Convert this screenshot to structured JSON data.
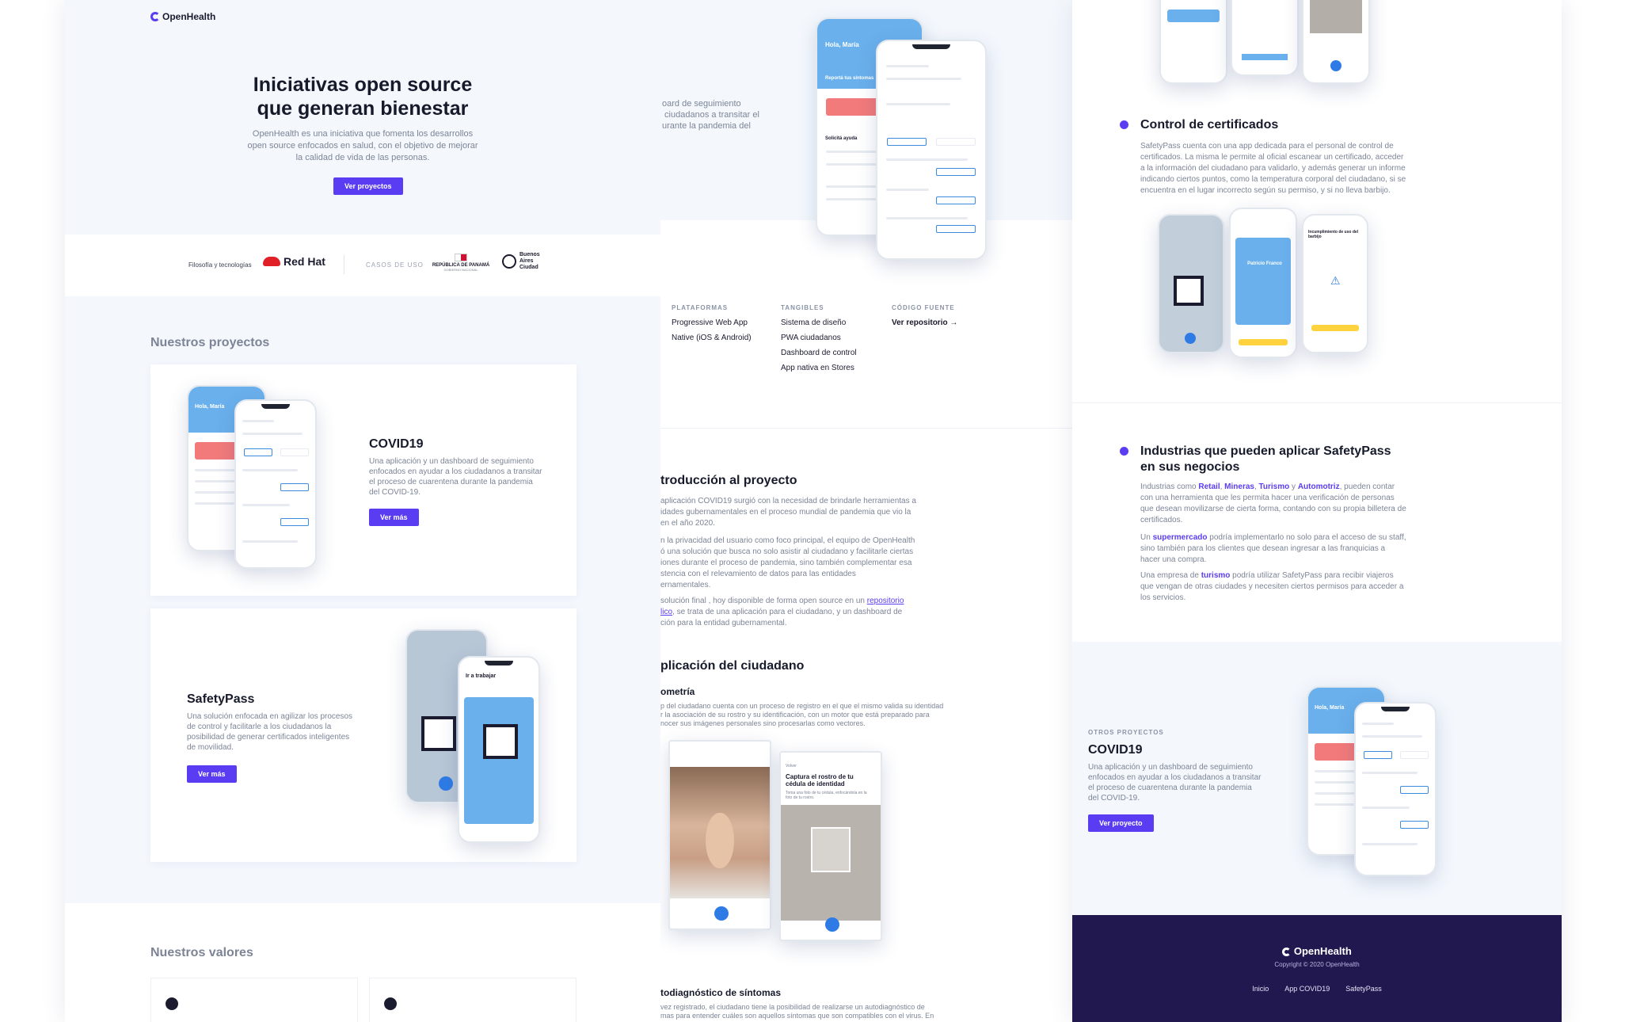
{
  "colors": {
    "accent": "#5a3df2",
    "footer_bg": "#21184f",
    "phone_blue": "#6ab0ec",
    "alert_red": "#f27a7a",
    "cta_yellow": "#ffd33d"
  },
  "brand": {
    "name": "OpenHealth"
  },
  "hero": {
    "title_line1": "Iniciativas open source",
    "title_line2": "que generan bienestar",
    "text": "OpenHealth es una iniciativa que fomenta los desarrollos open source enfocados en salud, con el objetivo de mejorar la calidad de vida de las personas.",
    "cta": "Ver proyectos"
  },
  "logos": {
    "filosofia": "Filosofía y tecnologías",
    "redhat": "Red Hat",
    "casos": "CASOS DE USO",
    "panama": "REPÚBLICA DE PANAMÁ",
    "panama_sub": "GOBIERNO NACIONAL",
    "ba_line1": "Buenos",
    "ba_line2": "Aires",
    "ba_line3": "Ciudad"
  },
  "projects": {
    "title": "Nuestros proyectos",
    "covid": {
      "title": "COVID19",
      "text": "Una aplicación y un dashboard de seguimiento enfocados en ayudar a los ciudadanos a transitar el proceso de cuarentena durante la pandemia del COVID-19.",
      "cta": "Ver más"
    },
    "safety": {
      "title": "SafetyPass",
      "text": "Una solución enfocada en agilizar los procesos de control y facilitarle a los ciudadanos la posibilidad de generar certificados inteligentes de movilidad.",
      "cta": "Ver más"
    }
  },
  "values": {
    "title": "Nuestros valores"
  },
  "detail": {
    "intro_cut": "oard de seguimiento\n ciudadanos a transitar el\nurante la pandemia del",
    "plataformas_head": "PLATAFORMAS",
    "plataformas": [
      "Progressive Web App",
      "Native (iOS & Android)"
    ],
    "tangibles_head": "TANGIBLES",
    "tangibles": [
      "Sistema de diseño",
      "PWA ciudadanos",
      "Dashboard de control",
      "App nativa en Stores"
    ],
    "codigo_head": "CÓDIGO FUENTE",
    "codigo_link": "Ver repositorio",
    "intro_title": "troducción al proyecto",
    "intro_p1": "aplicación COVID19 surgió con la necesidad de brindarle herramientas a\nidades gubernamentales en el proceso mundial de pandemia que vio la\nen el año 2020.",
    "intro_p2": "n la privacidad del usuario como foco principal, el equipo de OpenHealth\nó una solución que busca no solo asistir al ciudadano y facilitarle ciertas\niones durante el proceso de pandemia, sino también complementar esa\nstencia con el relevamiento de datos para las entidades\nernamentales.",
    "intro_p3_a": "solución final , hoy disponible de forma open source en un ",
    "intro_p3_link1": "repositorio",
    "intro_p3_link2": "lico",
    "intro_p3_b": ", se trata de una aplicación para el ciudadano, y un dashboard de\nción para la entidad gubernamental.",
    "app_title": "plicación del ciudadano",
    "biometria": "ometría",
    "biometria_p": "p del ciudadano cuenta con un proceso de registro en el que el mismo valida su identidad\nr la asociación de su rostro y su identificación, con un motor que está preparado para\nnocer sus imágenes personales sino procesarlas como vectores.",
    "capture_title": "Captura el rostro de tu cédula de identidad",
    "capture_hint": "Toma una foto de tu cédula, enfocándola en la foto de tu rostro.",
    "back": "Volver",
    "autodiag": "todiagnóstico de síntomas",
    "autodiag_p": "vez registrado, el ciudadano tiene la posibilidad de realizarse un autodiagnóstico de\nmas para entender cuáles son aquellos síntomas que son compatibles con el virus. En"
  },
  "safety": {
    "control_title": "Control de certificados",
    "control_text": "SafetyPass cuenta con una app dedicada para el personal de control de certificados. La misma le permite al oficial escanear un certificado, acceder a la información del ciudadano para validarlo, y además generar un informe indicando ciertos puntos, como la temperatura corporal del ciudadano, si se encuentra en el lugar incorrecto según su permiso, y si no lleva barbijo.",
    "phone_name": "Patricio Franco",
    "phone_warning": "Incumplimiento de uso del barbijo",
    "industries_title": "Industrias que pueden aplicar SafetyPass en sus negocios",
    "ind_p1_a": "Industrias como ",
    "ind_retail": "Retail",
    "ind_mineras": "Mineras",
    "ind_turismo": "Turismo",
    "ind_y": " y ",
    "ind_automotriz": "Automotriz",
    "ind_p1_b": ", pueden contar con una herramienta que les permita hacer una verificación de personas que desean movilizarse de cierta forma, contando con su propia billetera de certificados.",
    "ind_p2_a": "Un ",
    "ind_super": "supermercado",
    "ind_p2_b": " podría implementarlo no solo para el acceso de su staff, sino también para los clientes que desean ingresar a las franquicias a hacer una compra.",
    "ind_p3_a": "Una empresa de ",
    "ind_turismo2": "turismo",
    "ind_p3_b": " podría utilizar SafetyPass para recibir viajeros que vengan de otras ciudades y necesiten ciertos permisos para acceder a los servicios."
  },
  "others": {
    "label": "OTROS PROYECTOS",
    "title": "COVID19",
    "text": "Una aplicación y un dashboard de seguimiento enfocados en ayudar a los ciudadanos a transitar el proceso de cuarentena durante la pandemia del COVID-19.",
    "cta": "Ver proyecto"
  },
  "footer": {
    "logo": "OpenHealth",
    "copy": "Copyright © 2020 OpenHealth",
    "links": [
      "Inicio",
      "App COVID19",
      "SafetyPass"
    ]
  },
  "phone": {
    "greeting": "Hola, María",
    "report": "Reportá tus síntomas",
    "help": "Solicitá ayuda",
    "work": "Ir a trabajar"
  }
}
